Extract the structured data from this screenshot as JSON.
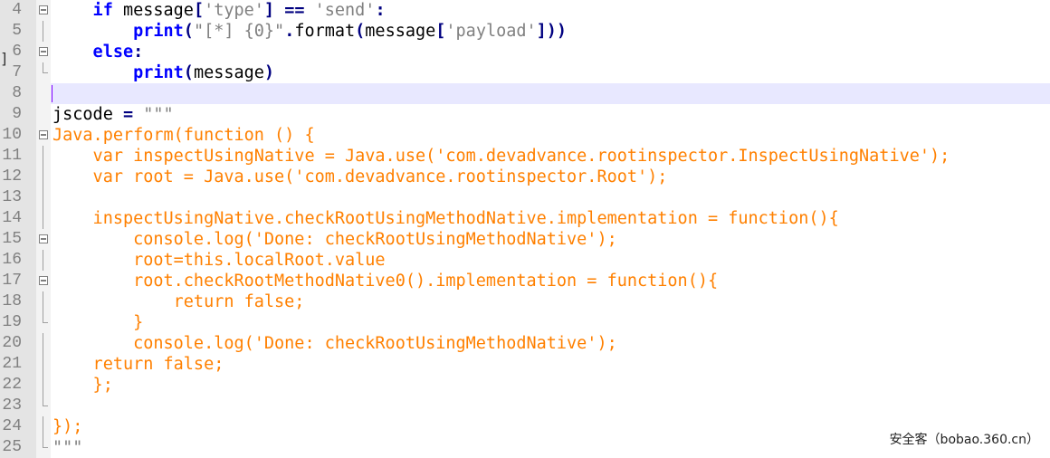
{
  "editor": {
    "lines": [
      {
        "num": "4",
        "segments": [
          [
            "py-kw",
            "    if "
          ],
          [
            "py-txt",
            "message"
          ],
          [
            "py-op",
            "["
          ],
          [
            "py-str",
            "'type'"
          ],
          [
            "py-op",
            "]"
          ],
          [
            "py-txt",
            " "
          ],
          [
            "py-op",
            "=="
          ],
          [
            "py-txt",
            " "
          ],
          [
            "py-str",
            "'send'"
          ],
          [
            "py-op",
            ":"
          ]
        ]
      },
      {
        "num": "5",
        "segments": [
          [
            "py-kw",
            "        print"
          ],
          [
            "py-op",
            "("
          ],
          [
            "py-strd",
            "\"[*] {0}\""
          ],
          [
            "py-op",
            "."
          ],
          [
            "py-txt",
            "format"
          ],
          [
            "py-op",
            "("
          ],
          [
            "py-txt",
            "message"
          ],
          [
            "py-op",
            "["
          ],
          [
            "py-str",
            "'payload'"
          ],
          [
            "py-op",
            "]))"
          ]
        ]
      },
      {
        "num": "6",
        "segments": [
          [
            "py-kw",
            "    else"
          ],
          [
            "py-op",
            ":"
          ]
        ]
      },
      {
        "num": "7",
        "segments": [
          [
            "py-kw",
            "        print"
          ],
          [
            "py-op",
            "("
          ],
          [
            "py-txt",
            "message"
          ],
          [
            "py-op",
            ")"
          ]
        ]
      },
      {
        "num": "8",
        "segments": []
      },
      {
        "num": "9",
        "segments": [
          [
            "py-txt",
            "jscode "
          ],
          [
            "py-op",
            "="
          ],
          [
            "py-txt",
            " "
          ],
          [
            "py-strd",
            "\"\"\""
          ]
        ]
      },
      {
        "num": "10",
        "segments": [
          [
            "js",
            "Java.perform(function () {"
          ]
        ]
      },
      {
        "num": "11",
        "segments": [
          [
            "js",
            "    var inspectUsingNative = Java.use('com.devadvance.rootinspector.InspectUsingNative');"
          ]
        ]
      },
      {
        "num": "12",
        "segments": [
          [
            "js",
            "    var root = Java.use('com.devadvance.rootinspector.Root');"
          ]
        ]
      },
      {
        "num": "13",
        "segments": []
      },
      {
        "num": "14",
        "segments": [
          [
            "js",
            "    inspectUsingNative.checkRootUsingMethodNative.implementation = function(){"
          ]
        ]
      },
      {
        "num": "15",
        "segments": [
          [
            "js",
            "        console.log('Done: checkRootUsingMethodNative');"
          ]
        ]
      },
      {
        "num": "16",
        "segments": [
          [
            "js",
            "        root=this.localRoot.value"
          ]
        ]
      },
      {
        "num": "17",
        "segments": [
          [
            "js",
            "        root.checkRootMethodNative0().implementation = function(){"
          ]
        ]
      },
      {
        "num": "18",
        "segments": [
          [
            "js",
            "            return false;"
          ]
        ]
      },
      {
        "num": "19",
        "segments": [
          [
            "js",
            "        }"
          ]
        ]
      },
      {
        "num": "20",
        "segments": [
          [
            "js",
            "        console.log('Done: checkRootUsingMethodNative');"
          ]
        ]
      },
      {
        "num": "21",
        "segments": [
          [
            "js",
            "    return false;"
          ]
        ]
      },
      {
        "num": "22",
        "segments": [
          [
            "js",
            "    };"
          ]
        ]
      },
      {
        "num": "23",
        "segments": []
      },
      {
        "num": "24",
        "segments": [
          [
            "js",
            "});"
          ]
        ]
      },
      {
        "num": "25",
        "segments": [
          [
            "py-strd",
            "\"\"\""
          ]
        ]
      }
    ]
  },
  "watermark": "安全客（bobao.360.cn）",
  "colors": {
    "keyword": "#0000ff",
    "string": "#808080",
    "js": "#ff8000",
    "current_line": "#e8e8ff"
  }
}
